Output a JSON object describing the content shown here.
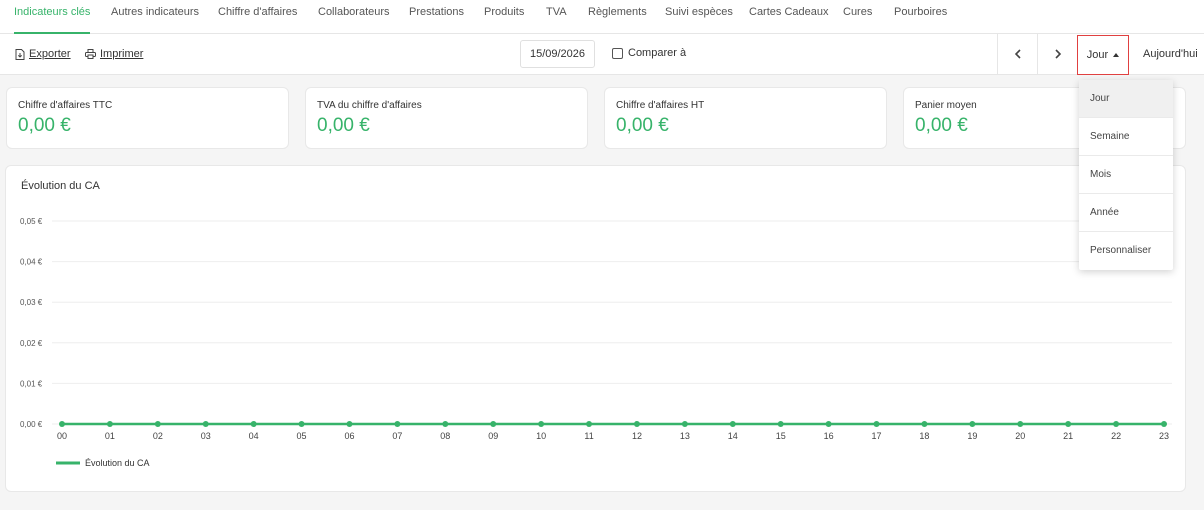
{
  "tabs": [
    {
      "label": "Indicateurs clés",
      "active": true
    },
    {
      "label": "Autres indicateurs"
    },
    {
      "label": "Chiffre d'affaires"
    },
    {
      "label": "Collaborateurs"
    },
    {
      "label": "Prestations"
    },
    {
      "label": "Produits"
    },
    {
      "label": "TVA"
    },
    {
      "label": "Règlements"
    },
    {
      "label": "Suivi espèces"
    },
    {
      "label": "Cartes Cadeaux"
    },
    {
      "label": "Cures"
    },
    {
      "label": "Pourboires"
    }
  ],
  "toolbar": {
    "export_label": "Exporter",
    "print_label": "Imprimer",
    "date": "15/09/2026",
    "compare_label": "Comparer à",
    "compare_checked": false,
    "period_label": "Jour",
    "today_label": "Aujourd'hui"
  },
  "kpis": [
    {
      "label": "Chiffre d'affaires TTC",
      "value": "0,00 €"
    },
    {
      "label": "TVA du chiffre d'affaires",
      "value": "0,00 €"
    },
    {
      "label": "Chiffre d'affaires HT",
      "value": "0,00 €"
    },
    {
      "label": "Panier moyen",
      "value": "0,00 €"
    }
  ],
  "period_menu": {
    "items": [
      "Jour",
      "Semaine",
      "Mois",
      "Année",
      "Personnaliser"
    ],
    "selected": "Jour"
  },
  "colors": {
    "accent": "#37b36a",
    "focus_border": "#e04040"
  },
  "chart_data": {
    "type": "line",
    "title": "Évolution du CA",
    "xlabel": "",
    "ylabel": "",
    "x": [
      "00",
      "01",
      "02",
      "03",
      "04",
      "05",
      "06",
      "07",
      "08",
      "09",
      "10",
      "11",
      "12",
      "13",
      "14",
      "15",
      "16",
      "17",
      "18",
      "19",
      "20",
      "21",
      "22",
      "23"
    ],
    "series": [
      {
        "name": "Évolution du CA",
        "values": [
          0,
          0,
          0,
          0,
          0,
          0,
          0,
          0,
          0,
          0,
          0,
          0,
          0,
          0,
          0,
          0,
          0,
          0,
          0,
          0,
          0,
          0,
          0,
          0
        ]
      }
    ],
    "yticks": [
      "0,00 €",
      "0,01 €",
      "0,02 €",
      "0,03 €",
      "0,04 €",
      "0,05 €"
    ],
    "ylim": [
      0,
      0.05
    ],
    "grid": true,
    "legend": "bottom-left"
  }
}
